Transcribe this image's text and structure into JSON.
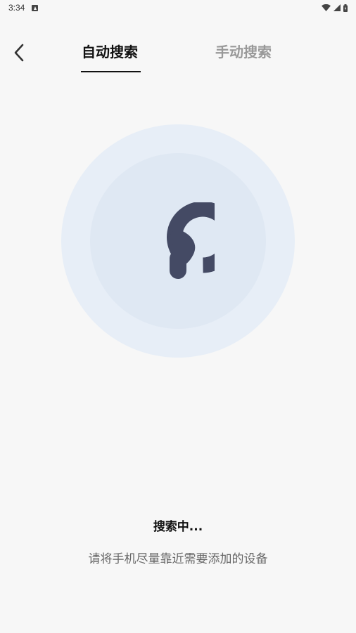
{
  "status_bar": {
    "time": "3:34"
  },
  "header": {
    "tabs": [
      {
        "label": "自动搜索",
        "active": true
      },
      {
        "label": "手动搜索",
        "active": false
      }
    ]
  },
  "main": {
    "status_title": "搜索中...",
    "hint": "请将手机尽量靠近需要添加的设备"
  },
  "colors": {
    "background": "#f7f7f7",
    "radar_outer": "#e7eef7",
    "radar_inner": "#dfe8f3",
    "logo": "#444a64",
    "tab_active": "#111111",
    "tab_inactive": "#999999"
  }
}
